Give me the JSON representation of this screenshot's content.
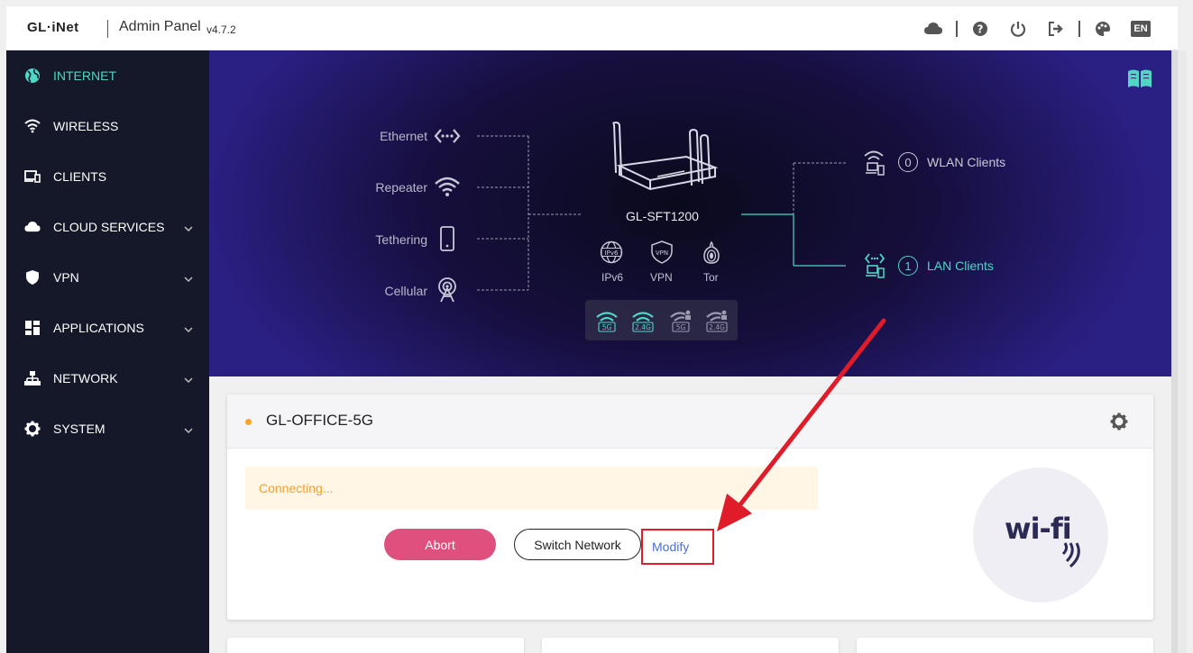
{
  "header": {
    "logo": "GL·iNet",
    "title": "Admin Panel",
    "version": "v4.7.2",
    "language": "EN",
    "icons": [
      "cloud-icon",
      "help-icon",
      "power-icon",
      "logout-icon",
      "theme-icon"
    ]
  },
  "sidebar": {
    "items": [
      {
        "label": "INTERNET",
        "icon": "globe-icon",
        "active": true
      },
      {
        "label": "WIRELESS",
        "icon": "wifi-icon"
      },
      {
        "label": "CLIENTS",
        "icon": "devices-icon"
      },
      {
        "label": "CLOUD SERVICES",
        "icon": "cloud-icon"
      },
      {
        "label": "VPN",
        "icon": "shield-icon"
      },
      {
        "label": "APPLICATIONS",
        "icon": "apps-icon"
      },
      {
        "label": "NETWORK",
        "icon": "network-icon"
      },
      {
        "label": "SYSTEM",
        "icon": "gear-icon"
      }
    ]
  },
  "topology": {
    "wan": [
      "Ethernet",
      "Repeater",
      "Tethering",
      "Cellular"
    ],
    "device": "GL-SFT1200",
    "features": [
      "IPv6",
      "VPN",
      "Tor"
    ],
    "bands": [
      "5G",
      "2.4G",
      "5G",
      "2.4G"
    ],
    "wlan_clients": {
      "count": "0",
      "label": "WLAN Clients"
    },
    "lan_clients": {
      "count": "1",
      "label": "LAN Clients"
    }
  },
  "network_card": {
    "ssid": "GL-OFFICE-5G",
    "status": "Connecting...",
    "abort_label": "Abort",
    "switch_label": "Switch Network",
    "modify_label": "Modify",
    "wifi_logo": "wi-fi"
  },
  "colors": {
    "accent": "#4fd6c4",
    "sidebar_bg": "#141829",
    "abort": "#e0507f",
    "warning": "#f5a623",
    "annotation": "#e01b2a",
    "link": "#4a6fd6"
  }
}
